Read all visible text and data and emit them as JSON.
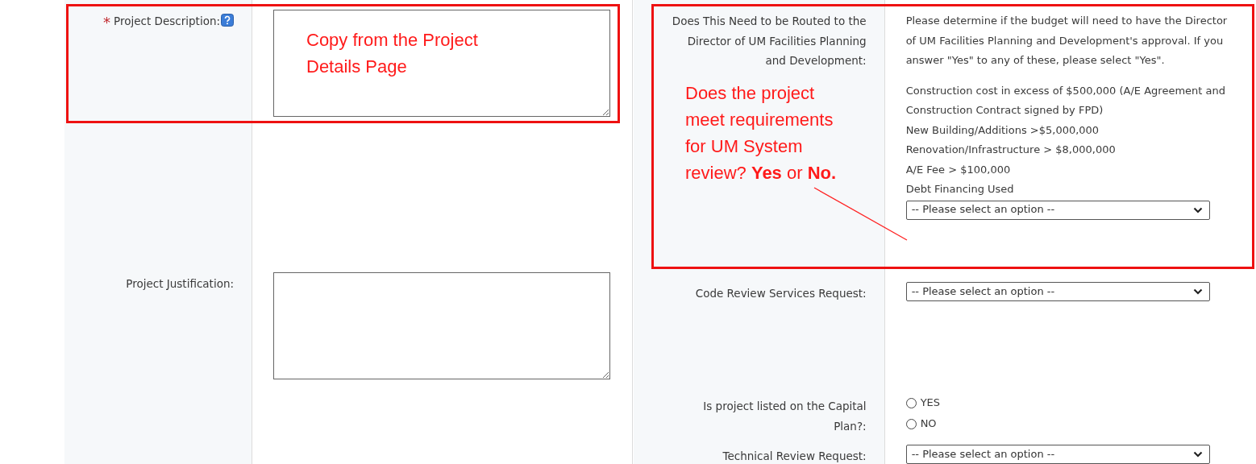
{
  "left_fields": [
    {
      "kind": "textarea",
      "required_mark": "*",
      "label": "Project Description:",
      "help": true
    },
    {
      "kind": "textarea",
      "label": "Project Justification:",
      "help": false
    }
  ],
  "right_fields": [
    {
      "kind": "select",
      "label": "Does This Need to be Routed to the Director of UM Facilities Planning and Development:",
      "description": "Please determine if the budget will need to have the Director of UM Facilities Planning and Development's approval.  If you answer \"Yes\" to any of these, please select \"Yes\".",
      "criteria": [
        "Construction cost in excess of $500,000 (A/E Agreement and Construction Contract signed by FPD)",
        "New Building/Additions >$5,000,000",
        "Renovation/Infrastructure > $8,000,000",
        "A/E Fee > $100,000",
        "Debt Financing Used"
      ],
      "value": "-- Please select an option --"
    },
    {
      "kind": "select",
      "label": "Code Review Services Request:",
      "value": "-- Please select an option --"
    },
    {
      "kind": "radio",
      "label": "Is project listed on the Capital Plan?:",
      "options": [
        {
          "label": "YES",
          "selected": false
        },
        {
          "label": "NO",
          "selected": false
        }
      ]
    },
    {
      "kind": "select",
      "label": "Technical Review Request:",
      "value": "-- Please select an option --"
    }
  ],
  "annotations": [
    {
      "kind": "note",
      "text": "Copy from the Project Details Page"
    },
    {
      "kind": "note",
      "text": "Does the project meet requirements for UM System review? **Yes** or **No.**"
    }
  ]
}
